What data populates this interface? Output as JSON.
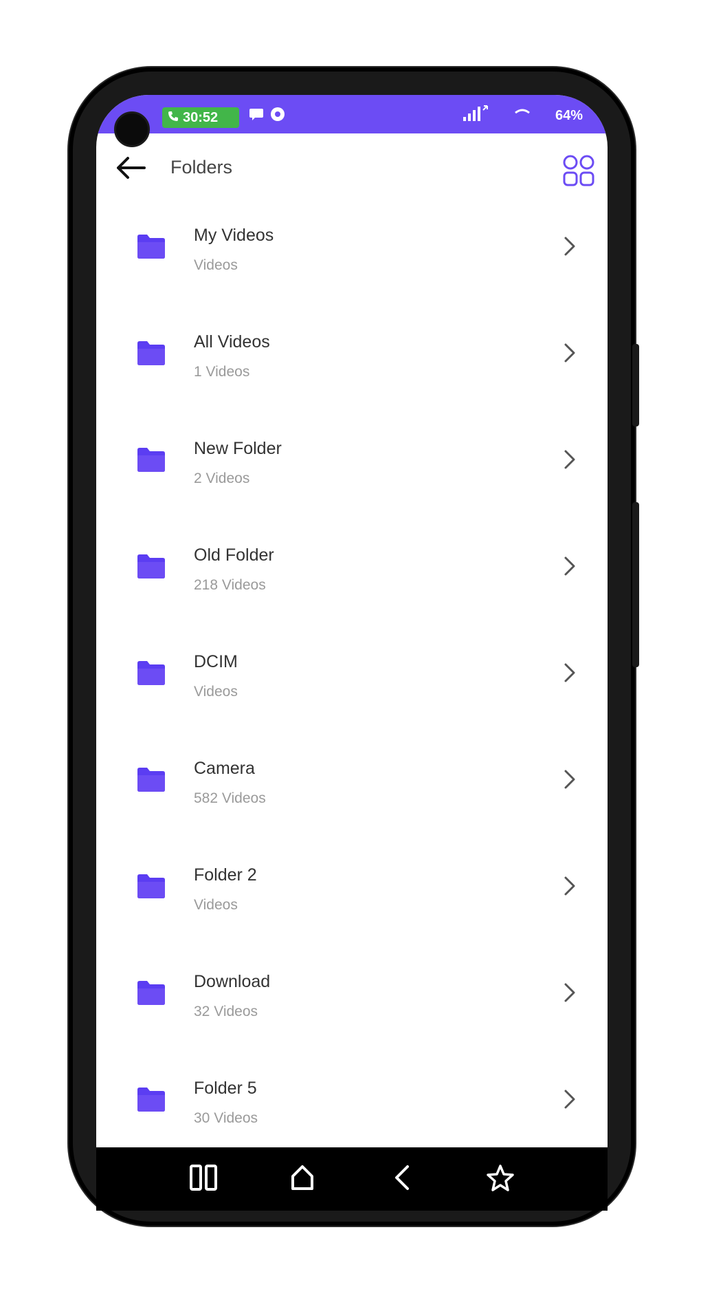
{
  "status_bar": {
    "call_time": "30:52",
    "battery": "64%",
    "accent_color": "#6c4cf4",
    "call_color": "#42b649"
  },
  "app_bar": {
    "title": "Folders",
    "back_icon": "arrow-left-icon",
    "view_toggle_icon": "grid-view-icon"
  },
  "folders": [
    {
      "name": "My Videos",
      "count": "Videos"
    },
    {
      "name": "All Videos",
      "count": "1 Videos"
    },
    {
      "name": "New Folder",
      "count": "2 Videos"
    },
    {
      "name": "Old Folder",
      "count": "218 Videos"
    },
    {
      "name": "DCIM",
      "count": "Videos"
    },
    {
      "name": "Camera",
      "count": "582 Videos"
    },
    {
      "name": "Folder 2",
      "count": "Videos"
    },
    {
      "name": "Download",
      "count": "32 Videos"
    },
    {
      "name": "Folder 5",
      "count": "30 Videos"
    }
  ],
  "nav_bar": {
    "items": [
      "recents-icon",
      "home-icon",
      "back-icon",
      "star-icon"
    ]
  }
}
